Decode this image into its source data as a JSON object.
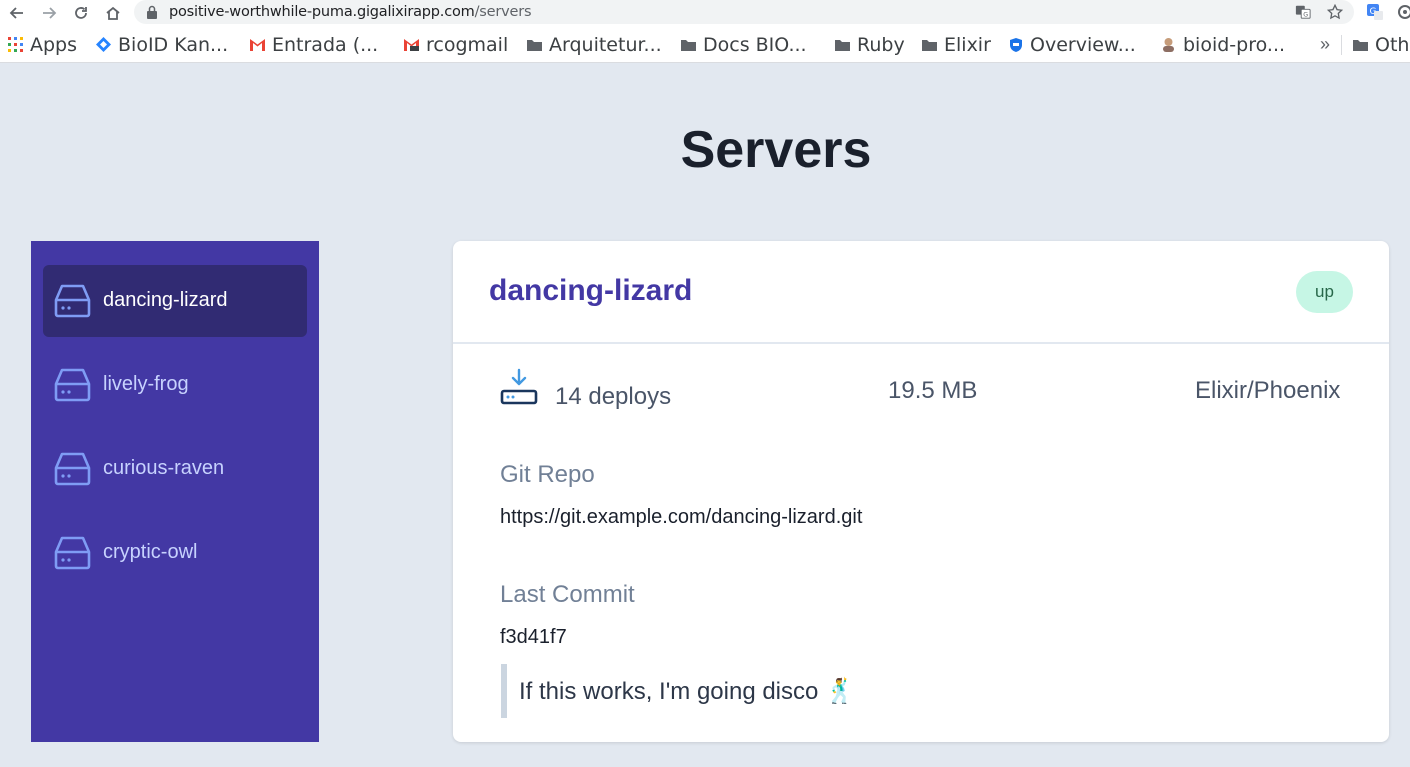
{
  "browser": {
    "url_host": "positive-worthwhile-puma.gigalixirapp.com",
    "url_path": "/servers"
  },
  "bookmarks": {
    "items": [
      {
        "label": "Apps",
        "icon": "apps-grid-icon"
      },
      {
        "label": "BioID Kan...",
        "icon": "diamond-icon"
      },
      {
        "label": "Entrada (...",
        "icon": "gmail-icon"
      },
      {
        "label": "rcogmail",
        "icon": "gmail-icon"
      },
      {
        "label": "Arquitetur...",
        "icon": "folder-icon"
      },
      {
        "label": "Docs BIO...",
        "icon": "folder-icon"
      },
      {
        "label": "Ruby",
        "icon": "folder-icon"
      },
      {
        "label": "Elixir",
        "icon": "folder-icon"
      },
      {
        "label": "Overview...",
        "icon": "shield-icon"
      },
      {
        "label": "bioid-pro...",
        "icon": "avatar-icon"
      },
      {
        "label": "Oth",
        "icon": "folder-icon"
      }
    ],
    "more": "»"
  },
  "page": {
    "title": "Servers"
  },
  "sidebar": {
    "items": [
      {
        "label": "dancing-lizard",
        "active": true
      },
      {
        "label": "lively-frog",
        "active": false
      },
      {
        "label": "curious-raven",
        "active": false
      },
      {
        "label": "cryptic-owl",
        "active": false
      }
    ]
  },
  "server": {
    "name": "dancing-lizard",
    "status": "up",
    "deploys": "14 deploys",
    "size": "19.5 MB",
    "stack": "Elixir/Phoenix",
    "git_repo_label": "Git Repo",
    "git_repo": "https://git.example.com/dancing-lizard.git",
    "last_commit_label": "Last Commit",
    "last_commit": "f3d41f7",
    "commit_message": "If this works, I'm going disco 🕺"
  },
  "colors": {
    "sidebar_bg": "#4338a4",
    "sidebar_active": "#312b73",
    "accent": "#4338a4",
    "status_bg": "#c6f6e5",
    "page_bg": "#e2e8f0"
  }
}
